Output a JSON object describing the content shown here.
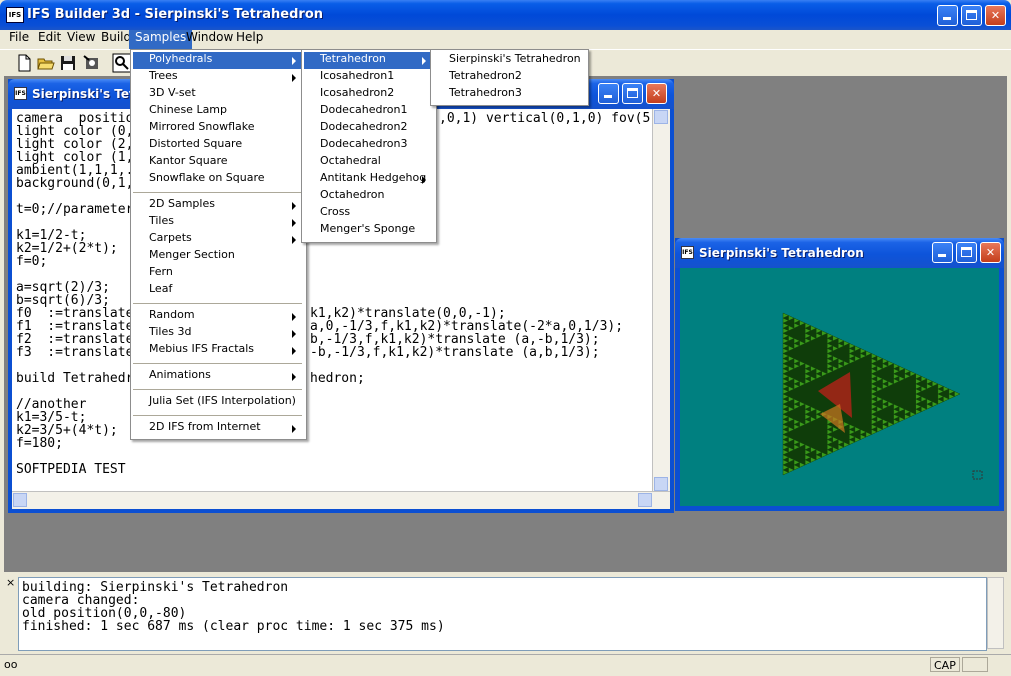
{
  "window": {
    "icon_text": "IFS",
    "title": "IFS Builder 3d - Sierpinski's Tetrahedron"
  },
  "menubar": [
    "File",
    "Edit",
    "View",
    "Build",
    "Samples",
    "Window",
    "Help"
  ],
  "samples_menu": {
    "items": [
      "Polyhedrals",
      "Trees",
      "3D V-set",
      "Chinese Lamp",
      "Mirrored Snowflake",
      "Distorted Square",
      "Kantor Square",
      "Snowflake on Square",
      "2D Samples",
      "Tiles",
      "Carpets",
      "Menger Section",
      "Fern",
      "Leaf",
      "Random",
      "Tiles 3d",
      "Mebius IFS Fractals",
      "Animations",
      "Julia Set (IFS Interpolation)",
      "2D IFS from Internet"
    ],
    "selected": "Polyhedrals"
  },
  "polyhedrals_menu": {
    "items": [
      "Tetrahedron",
      "Icosahedron1",
      "Icosahedron2",
      "Dodecahedron1",
      "Dodecahedron2",
      "Dodecahedron3",
      "Octahedral",
      "Antitank Hedgehog",
      "Octahedron",
      "Cross",
      "Menger's Sponge"
    ],
    "selected": "Tetrahedron"
  },
  "tetrahedron_menu": {
    "items": [
      "Sierpinski's Tetrahedron",
      "Tetrahedron2",
      "Tetrahedron3"
    ]
  },
  "editor": {
    "title": "Sierpinski's Tetrahedron",
    "title_visible": "Sierpinski's Tetra",
    "lines": [
      "camera  positio",
      "light color (0,",
      "light color (2,",
      "light color (1,",
      "ambient(1,1,1,.",
      "background(0,1,",
      "",
      "t=0;//parameter",
      "",
      "k1=1/2-t;",
      "k2=1/2+(2*t);",
      "f=0;",
      "",
      "a=sqrt(2)/3;",
      "b=sqrt(6)/3;",
      "f0  :=translate(",
      "f1  :=translate(",
      "f2  :=translate(",
      "f3  :=translate(",
      "",
      "build Tetrahedr",
      "",
      "//another",
      "k1=3/5-t;",
      "k2=3/5+(4*t);",
      "f=180;",
      "",
      "SOFTPEDIA TEST"
    ],
    "right_fragments": [
      {
        "line": 0,
        "text": ",0,1) vertical(0,1,0) fov(5"
      },
      {
        "line": 15,
        "text": "k1,k2)*translate(0,0,-1);"
      },
      {
        "line": 16,
        "text": "a,0,-1/3,f,k1,k2)*translate(-2*a,0,1/3);"
      },
      {
        "line": 17,
        "text": "b,-1/3,f,k1,k2)*translate (a,-b,1/3);"
      },
      {
        "line": 18,
        "text": "-b,-1/3,f,k1,k2)*translate (a,b,1/3);"
      },
      {
        "line": 20,
        "text": "hedron;"
      }
    ]
  },
  "viewer": {
    "title": "Sierpinski's Tetrahedron",
    "background": "#008080",
    "fractal_color": "#3a9a1a",
    "fractal_dark": "#0f3d0a",
    "highlight": "#c0201a"
  },
  "output": {
    "close_glyph": "×",
    "lines": [
      "building: Sierpinski's Tetrahedron",
      "camera changed:",
      "old position(0,0,-80)",
      "finished: 1 sec 687 ms (clear proc time: 1 sec 375 ms)"
    ]
  },
  "statusbar": {
    "left": "oo",
    "cap": "CAP"
  },
  "colors": {
    "xp_blue": "#0b4fd2",
    "menu_highlight": "#316ac5",
    "mdi_background": "#808080"
  }
}
